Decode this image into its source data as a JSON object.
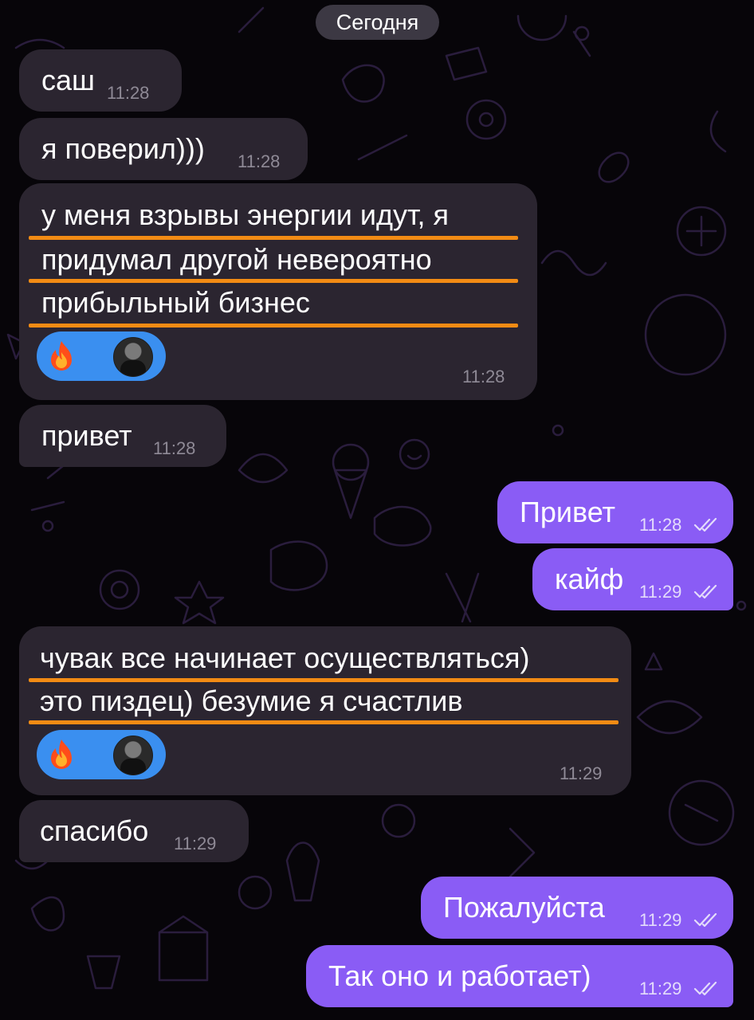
{
  "date_separator": "Сегодня",
  "messages": [
    {
      "text": "саш",
      "time": "11:28"
    },
    {
      "text": "я поверил)))",
      "time": "11:28"
    },
    {
      "lines": [
        "у меня взрывы энергии идут, я",
        "придумал другой невероятно",
        "прибыльный бизнес"
      ],
      "time": "11:28",
      "reaction": "🔥"
    },
    {
      "text": "привет",
      "time": "11:28"
    },
    {
      "text": "Привет",
      "time": "11:28"
    },
    {
      "text": "кайф",
      "time": "11:29"
    },
    {
      "lines": [
        "чувак все начинает осуществляться)",
        "это пиздец) безумие я счастлив"
      ],
      "time": "11:29",
      "reaction": "🔥"
    },
    {
      "text": "спасибо",
      "time": "11:29"
    },
    {
      "text": "Пожалуйста",
      "time": "11:29"
    },
    {
      "text": "Так оно и работает)",
      "time": "11:29"
    }
  ],
  "colors": {
    "background": "#070509",
    "incoming_bubble": "#2b2530",
    "outgoing_bubble": "#8a5cf5",
    "reaction": "#3a8ff0",
    "highlight_underline": "#f28b14"
  },
  "icons": {
    "read_receipt": "double-check-icon",
    "reaction": "fire-icon",
    "reactor": "avatar"
  }
}
